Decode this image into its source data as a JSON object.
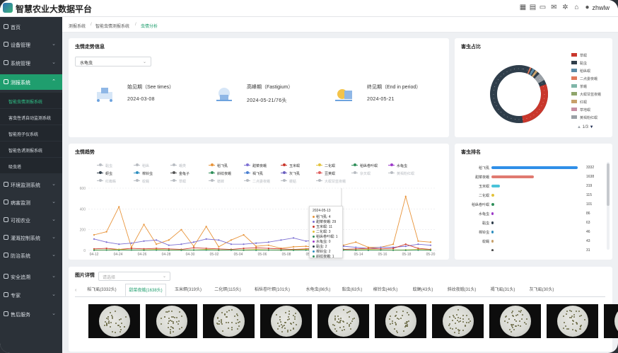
{
  "header": {
    "app_title": "智慧农业大数据平台",
    "username": "zhwlw"
  },
  "sidebar": {
    "items": [
      {
        "label": "首页"
      },
      {
        "label": "设备管理"
      },
      {
        "label": "系统管理"
      },
      {
        "label": "测报系统"
      },
      {
        "label": "环境监测系统"
      },
      {
        "label": "病害监测"
      },
      {
        "label": "可视农业"
      },
      {
        "label": "灌溉控制系统"
      },
      {
        "label": "防治系统"
      },
      {
        "label": "安全追溯"
      },
      {
        "label": "专家"
      },
      {
        "label": "售后服务"
      }
    ],
    "sub_items": [
      {
        "label": "智能虫情测报系统"
      },
      {
        "label": "害虫性诱自动监测系统"
      },
      {
        "label": "智能孢子仪系统"
      },
      {
        "label": "智能色诱测报系统"
      },
      {
        "label": "吸虫塔"
      }
    ]
  },
  "breadcrumb": {
    "items": [
      "测报系统",
      "智能虫情测报系统",
      "虫情分析"
    ]
  },
  "trend_info": {
    "title": "虫情走势信息",
    "selected_pest": "水龟虫",
    "periods": [
      {
        "label": "始见期（See times）",
        "value": "2024-03-08"
      },
      {
        "label": "高峰期（Fastigium）",
        "value": "2024-05-21/76头"
      },
      {
        "label": "终见期（End in period）",
        "value": "2024-05-21"
      }
    ]
  },
  "proportion": {
    "title": "害虫占比",
    "pager": "1/3",
    "legend": [
      "草螟",
      "黏虫",
      "稻纵螟",
      "二点委夜蛾",
      "茶蛾",
      "大螟甘蓝夜蛾",
      "红螟",
      "草地螟",
      "黄褐粉红螟"
    ],
    "colors": [
      "#c9372c",
      "#2f3e4b",
      "#5b8ba6",
      "#e0795c",
      "#7fb6a8",
      "#8fa56b",
      "#c7a06a",
      "#c68ea3",
      "#9aa0a6"
    ]
  },
  "trend": {
    "title": "虫情趋势",
    "legend": [
      "黏虫",
      "稻纵",
      "蛾类",
      "稻飞虱",
      "甜菜夜蛾",
      "玉米螟",
      "二化螟",
      "稻纵卷叶螟",
      "水龟虫",
      "蚜虫",
      "棉铃虫",
      "金龟子",
      "斜纹夜蛾",
      "褐飞虱",
      "灰飞虱",
      "豆荚螟",
      "杂叉螟",
      "黄褐粉红螟",
      "红蜘蛛",
      "蚊蝇",
      "草螟",
      "蟋蟀",
      "二点委夜蛾",
      "蝼蛄",
      "大螟甘蓝夜蛾"
    ],
    "legend_colors": [
      "#b8bcc2",
      "#b8bcc2",
      "#b8bcc2",
      "#e8943a",
      "#7c6fd3",
      "#c9372c",
      "#e2c23a",
      "#2f8f5a",
      "#9d3ac9",
      "#2f3e4b",
      "#2f8fbf",
      "#555",
      "#2f8f5a",
      "#4a7fd1",
      "#6b5fbf",
      "#e06060",
      "#b8bcc2",
      "#b8bcc2",
      "#b8bcc2",
      "#b8bcc2",
      "#b8bcc2",
      "#b8bcc2",
      "#b8bcc2",
      "#b8bcc2",
      "#b8bcc2"
    ],
    "tooltip": {
      "date": "2024-05-13",
      "rows": [
        "稻飞虱: 4",
        "甜菜夜蛾: 29",
        "玉米螟: 11",
        "二化螟: 3",
        "稻纵卷叶螟: 1",
        "水龟虫: 0",
        "黏虫: 2",
        "棉铃虫: 2",
        "斜纹夜蛾: 1"
      ],
      "colors": [
        "#e8943a",
        "#7c6fd3",
        "#c9372c",
        "#e2c23a",
        "#2f8f5a",
        "#9d3ac9",
        "#2f3e4b",
        "#2f8fbf",
        "#2f8f5a"
      ]
    }
  },
  "chart_data": {
    "type": "line",
    "x": [
      "04-12",
      "04-24",
      "04-26",
      "04-28",
      "04-30",
      "05-02",
      "05-04",
      "05-06",
      "05-08",
      "05-10",
      "05-12",
      "05-14",
      "05-16",
      "05-18",
      "05-20"
    ],
    "ylim": [
      0,
      600
    ],
    "yticks": [
      600,
      400,
      200,
      0
    ],
    "series": [
      {
        "name": "稻飞虱",
        "color": "#e8943a",
        "values": [
          150,
          180,
          420,
          30,
          250,
          60,
          100,
          200,
          40,
          230,
          35,
          100,
          150,
          40,
          50,
          20,
          35,
          40,
          25,
          60,
          50,
          80,
          30,
          30,
          60,
          520,
          90,
          80
        ]
      },
      {
        "name": "甜菜夜蛾",
        "color": "#7c6fd3",
        "values": [
          110,
          80,
          60,
          70,
          90,
          100,
          50,
          60,
          80,
          110,
          100,
          60,
          60,
          70,
          80,
          100,
          120,
          90,
          100,
          70,
          40,
          30,
          20,
          30,
          30,
          40,
          60,
          50
        ]
      },
      {
        "name": "玉米螟",
        "color": "#c9372c",
        "values": [
          15,
          20,
          10,
          20,
          15,
          20,
          15,
          10,
          25,
          20,
          15,
          10,
          20,
          25,
          20,
          15,
          10,
          15,
          20,
          15,
          10,
          15,
          20,
          15,
          20,
          60,
          20,
          10
        ]
      },
      {
        "name": "二化螟",
        "color": "#e2c23a",
        "values": [
          5,
          5,
          10,
          5,
          5,
          10,
          5,
          5,
          5,
          10,
          5,
          5,
          5,
          10,
          5,
          5,
          5,
          10,
          5,
          5,
          5,
          5,
          10,
          5,
          5,
          5,
          10,
          5
        ]
      },
      {
        "name": "稻纵卷叶螟",
        "color": "#2f8f5a",
        "values": [
          2,
          3,
          2,
          4,
          2,
          3,
          2,
          2,
          3,
          4,
          2,
          3,
          2,
          2,
          3,
          2,
          2,
          3,
          2,
          2,
          3,
          2,
          2,
          3,
          2,
          2,
          3,
          2
        ]
      }
    ]
  },
  "ranking": {
    "title": "害虫排名",
    "rows": [
      {
        "name": "稻飞虱",
        "value": "3332",
        "num": 3332,
        "color": "#2f8fe8"
      },
      {
        "name": "甜菜夜蛾",
        "value": "1638",
        "num": 1638,
        "color": "#e07a70"
      },
      {
        "name": "玉米螟",
        "value": "319",
        "num": 319,
        "color": "#4ac3d9"
      },
      {
        "name": "二化螟",
        "value": "115",
        "num": 115,
        "color": "#e2c23a"
      },
      {
        "name": "稻纵卷叶螟",
        "value": "101",
        "num": 101,
        "color": "#2f8f5a"
      },
      {
        "name": "水龟虫",
        "value": "86",
        "num": 86,
        "color": "#9d3ac9"
      },
      {
        "name": "黏虫",
        "value": "63",
        "num": 63,
        "color": "#2f3e4b"
      },
      {
        "name": "棉铃虫",
        "value": "46",
        "num": 46,
        "color": "#2f8fbf"
      },
      {
        "name": "蚊蝇",
        "value": "43",
        "num": 43,
        "color": "#c7a06a"
      },
      {
        "name": "",
        "value": "31",
        "num": 31,
        "color": "#555"
      }
    ]
  },
  "images": {
    "title": "图片详情",
    "select_placeholder": "请选择",
    "tabs": [
      "稻飞虱(3332头)",
      "甜菜夜蛾(1638头)",
      "玉米螟(319头)",
      "二化螟(115头)",
      "稻纵卷叶螟(101头)",
      "水龟虫(86头)",
      "黏虫(63头)",
      "棉铃虫(46头)",
      "蚊蝇(43头)",
      "斜纹夜蛾(31头)",
      "褐飞虱(31头)",
      "灰飞虱(30头)"
    ]
  }
}
